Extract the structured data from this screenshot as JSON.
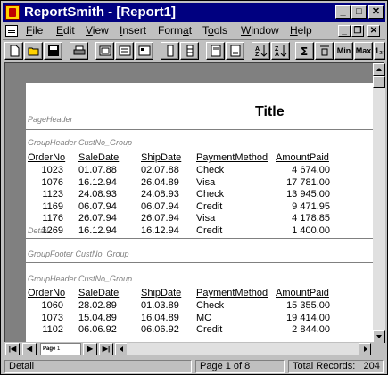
{
  "window": {
    "title": "ReportSmith - [Report1]"
  },
  "title_controls": {
    "minimize": "_",
    "maximize": "□",
    "close": "✕"
  },
  "menu": {
    "items": [
      {
        "label": "File",
        "u": "F",
        "rest": "ile"
      },
      {
        "label": "Edit",
        "u": "E",
        "rest": "dit"
      },
      {
        "label": "View",
        "u": "V",
        "rest": "iew"
      },
      {
        "label": "Insert",
        "u": "I",
        "rest": "nsert"
      },
      {
        "label": "Format",
        "pre": "Form",
        "u": "a",
        "rest": "t"
      },
      {
        "label": "Tools",
        "pre": "T",
        "u": "o",
        "rest": "ols"
      },
      {
        "label": "Window",
        "u": "W",
        "rest": "indow"
      },
      {
        "label": "Help",
        "u": "H",
        "rest": "elp"
      }
    ],
    "mdi_minimize": "_",
    "mdi_restore": "❐",
    "mdi_close": "✕"
  },
  "toolbar": {
    "buttons": [
      {
        "name": "new-icon"
      },
      {
        "name": "open-icon"
      },
      {
        "name": "save-icon"
      },
      {
        "name": "print-icon"
      },
      {
        "name": "preview-icon"
      },
      {
        "name": "page-width-icon"
      },
      {
        "name": "report-icon"
      },
      {
        "name": "columnar-icon"
      },
      {
        "name": "crosstab-icon"
      },
      {
        "name": "form-icon"
      },
      {
        "name": "label-icon"
      },
      {
        "name": "sort-ascending-icon"
      },
      {
        "name": "sort-descending-icon"
      },
      {
        "name": "sum-icon"
      },
      {
        "name": "field-icon"
      }
    ],
    "min_label": "Min",
    "max_label": "Max",
    "extra_label": "1₂₃"
  },
  "report": {
    "page_header_label": "PageHeader",
    "title": "Title",
    "group_header_label": "GroupHeader CustNo_Group",
    "group_footer_label": "GroupFooter CustNo_Group",
    "detail_label": "Detail",
    "columns": [
      "OrderNo",
      "SaleDate",
      "ShipDate",
      "PaymentMethod",
      "AmountPaid"
    ],
    "group1_rows": [
      [
        "1023",
        "01.07.88",
        "02.07.88",
        "Check",
        "4 674.00"
      ],
      [
        "1076",
        "16.12.94",
        "26.04.89",
        "Visa",
        "17 781.00"
      ],
      [
        "1123",
        "24.08.93",
        "24.08.93",
        "Check",
        "13 945.00"
      ],
      [
        "1169",
        "06.07.94",
        "06.07.94",
        "Credit",
        "9 471.95"
      ],
      [
        "1176",
        "26.07.94",
        "26.07.94",
        "Visa",
        "4 178.85"
      ],
      [
        "1269",
        "16.12.94",
        "16.12.94",
        "Credit",
        "1 400.00"
      ]
    ],
    "group2_rows": [
      [
        "1060",
        "28.02.89",
        "01.03.89",
        "Check",
        "15 355.00"
      ],
      [
        "1073",
        "15.04.89",
        "16.04.89",
        "MC",
        "19 414.00"
      ],
      [
        "1102",
        "06.06.92",
        "06.06.92",
        "Credit",
        "2 844.00"
      ]
    ]
  },
  "navigator": {
    "first": "|◀",
    "prev": "◀",
    "page_label": "Page",
    "page_value": "1",
    "next": "▶",
    "last": "▶|"
  },
  "status": {
    "mode": "Detail",
    "page": "Page 1 of 8",
    "total_label": "Total Records:",
    "total_value": "204"
  },
  "colors": {
    "titlebar": "#000080",
    "face": "#c0c0c0",
    "workspace": "#808080"
  }
}
